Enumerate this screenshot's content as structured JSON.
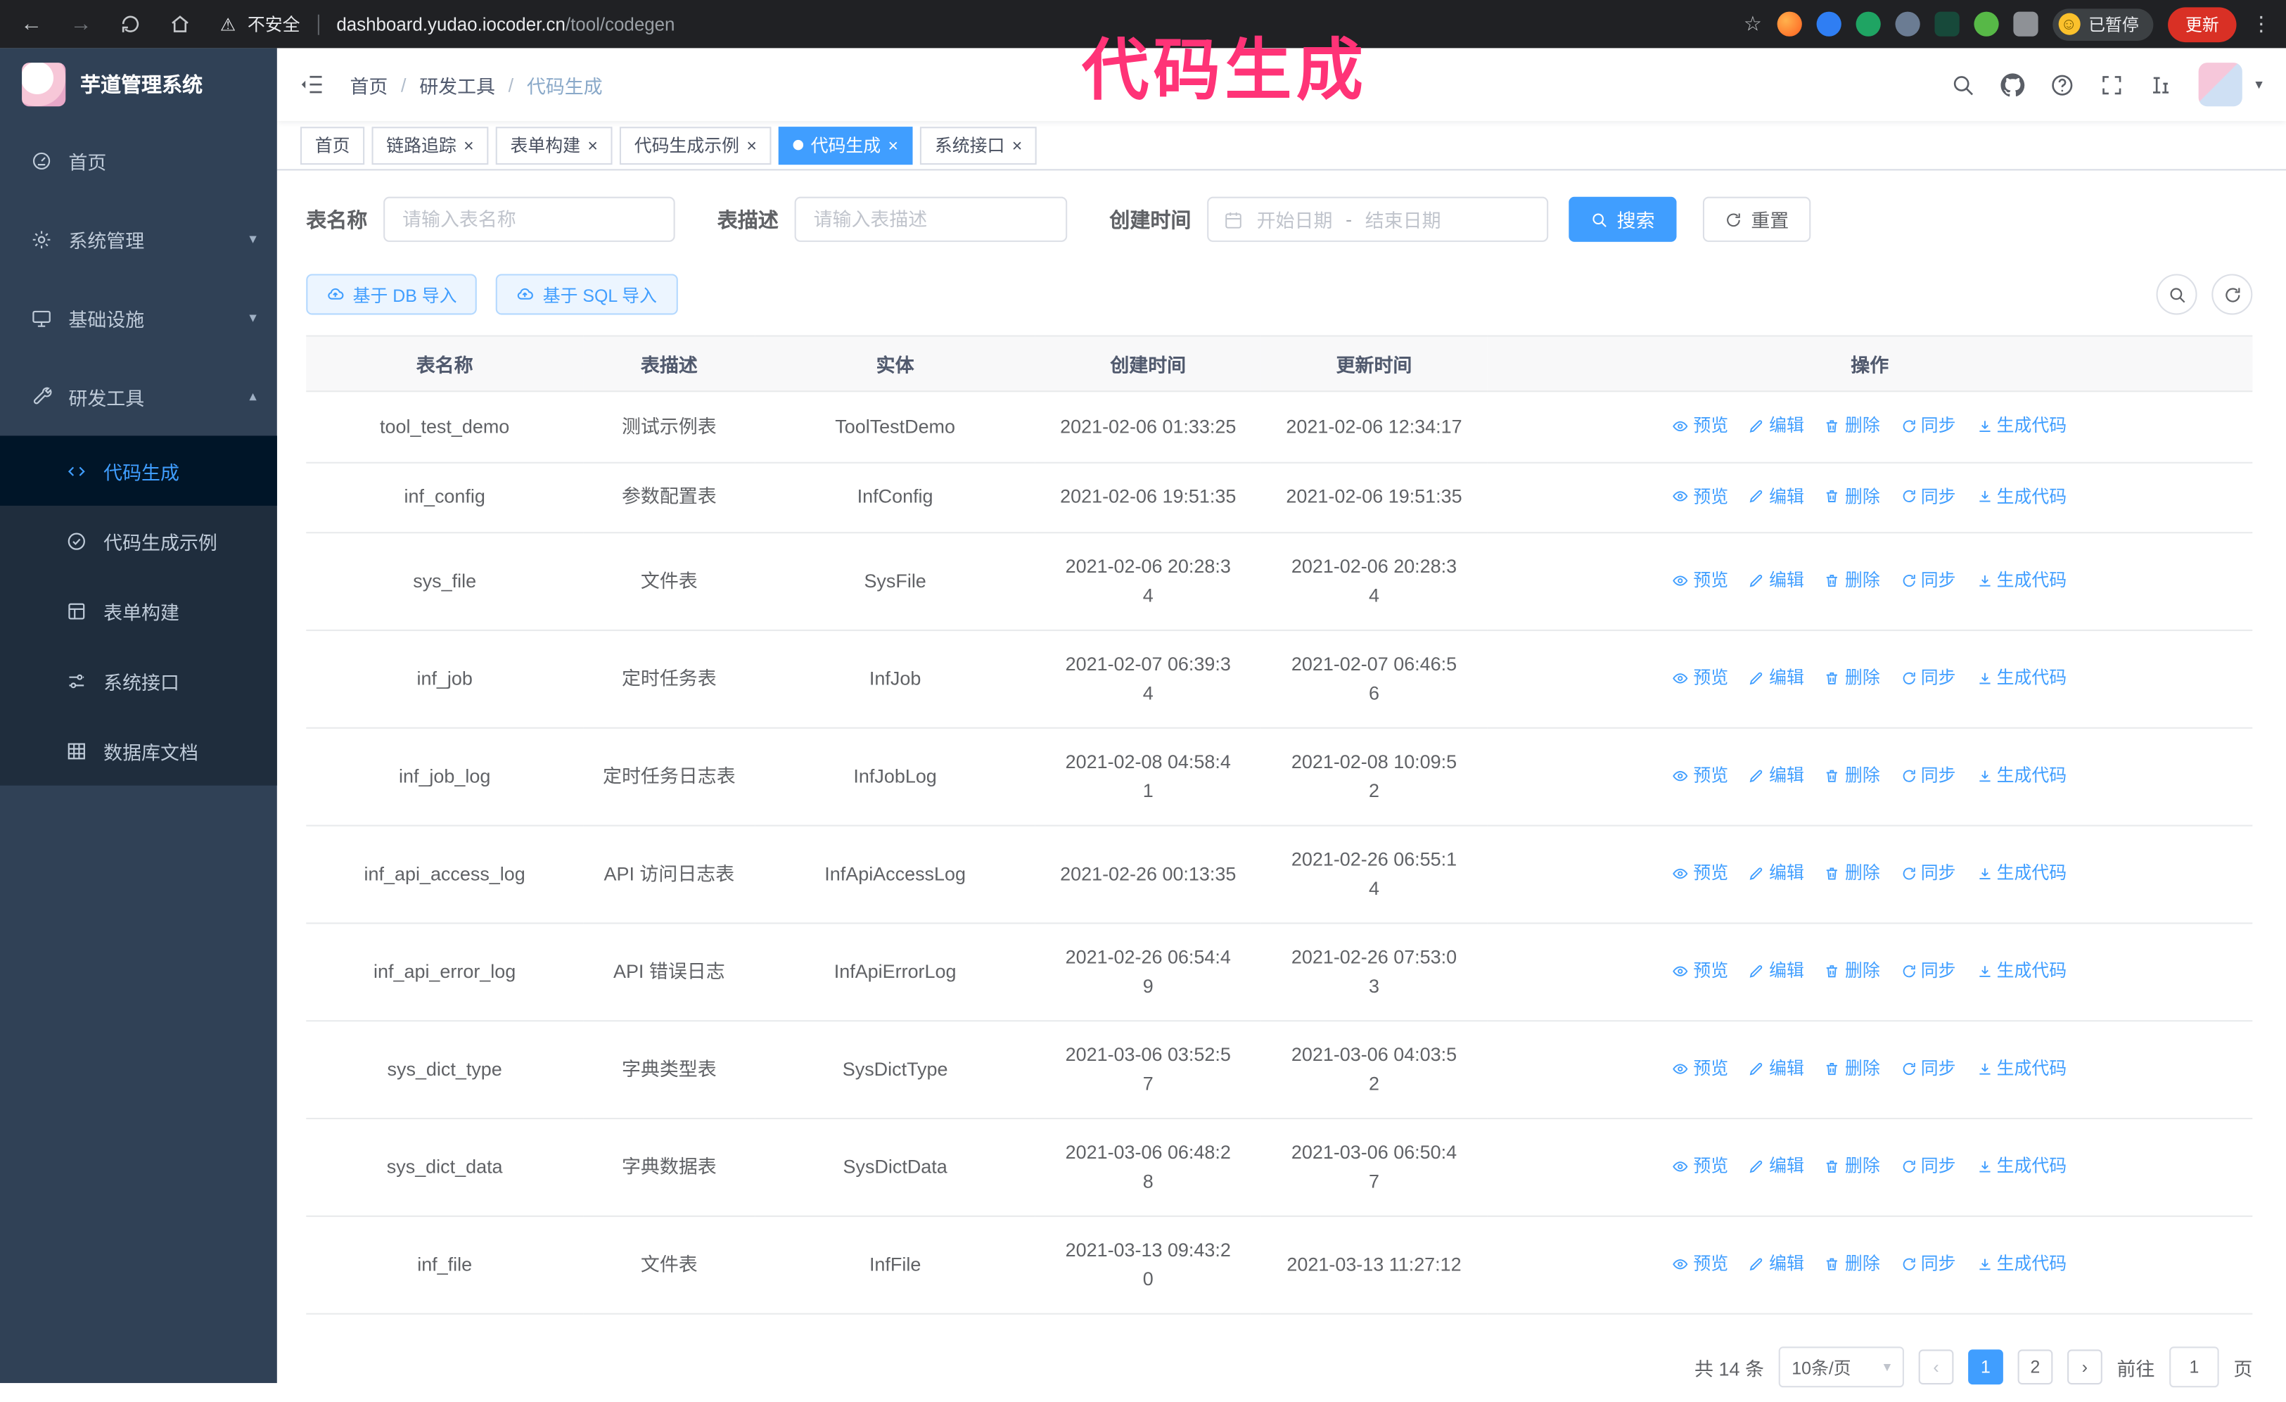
{
  "colors": {
    "accent": "#409eff",
    "sidebar_bg": "#304156",
    "submenu_bg": "#1f2d3d",
    "annotation": "#ff3377",
    "update_badge": "#d93025"
  },
  "icons": {
    "back": "←",
    "forward": "→",
    "star": "☆",
    "warning": "⚠",
    "dots": "⋮",
    "caret_down": "▾",
    "caret_up": "▴",
    "smiley": "☺",
    "close": "×",
    "prev": "‹",
    "next": "›"
  },
  "annotation": {
    "text": "代码生成"
  },
  "browser": {
    "security_warning": "不安全",
    "url_domain": "dashboard.yudao.iocoder.cn",
    "url_path": "/tool/codegen",
    "paused_badge": "已暂停",
    "update_button": "更新"
  },
  "sidebar": {
    "app_title": "芋道管理系统",
    "items": [
      {
        "label": "首页"
      },
      {
        "label": "系统管理"
      },
      {
        "label": "基础设施"
      },
      {
        "label": "研发工具"
      }
    ],
    "subitems": [
      {
        "label": "代码生成",
        "active": true
      },
      {
        "label": "代码生成示例"
      },
      {
        "label": "表单构建"
      },
      {
        "label": "系统接口"
      },
      {
        "label": "数据库文档"
      }
    ]
  },
  "header": {
    "breadcrumb": [
      "首页",
      "研发工具",
      "代码生成"
    ],
    "separator": "/"
  },
  "tabs": [
    {
      "label": "首页"
    },
    {
      "label": "链路追踪"
    },
    {
      "label": "表单构建"
    },
    {
      "label": "代码生成示例"
    },
    {
      "label": "代码生成"
    },
    {
      "label": "系统接口"
    }
  ],
  "filters": {
    "table_name_label": "表名称",
    "table_name_placeholder": "请输入表名称",
    "table_desc_label": "表描述",
    "table_desc_placeholder": "请输入表描述",
    "create_time_label": "创建时间",
    "start_date_placeholder": "开始日期",
    "range_separator": "-",
    "end_date_placeholder": "结束日期",
    "search_label": "搜索",
    "reset_label": "重置"
  },
  "toolbar": {
    "import_db_label": "基于 DB 导入",
    "import_sql_label": "基于 SQL 导入"
  },
  "table": {
    "columns": [
      "表名称",
      "表描述",
      "实体",
      "创建时间",
      "更新时间",
      "操作"
    ],
    "actions": [
      "预览",
      "编辑",
      "删除",
      "同步",
      "生成代码"
    ],
    "rows": [
      {
        "name": "tool_test_demo",
        "desc": "测试示例表",
        "entity": "ToolTestDemo",
        "created": "2021-02-06 01:33:25",
        "updated": "2021-02-06 12:34:17"
      },
      {
        "name": "inf_config",
        "desc": "参数配置表",
        "entity": "InfConfig",
        "created": "2021-02-06 19:51:35",
        "updated": "2021-02-06 19:51:35"
      },
      {
        "name": "sys_file",
        "desc": "文件表",
        "entity": "SysFile",
        "created": "2021-02-06 20:28:3\n4",
        "updated": "2021-02-06 20:28:3\n4"
      },
      {
        "name": "inf_job",
        "desc": "定时任务表",
        "entity": "InfJob",
        "created": "2021-02-07 06:39:3\n4",
        "updated": "2021-02-07 06:46:5\n6"
      },
      {
        "name": "inf_job_log",
        "desc": "定时任务日志表",
        "entity": "InfJobLog",
        "created": "2021-02-08 04:58:4\n1",
        "updated": "2021-02-08 10:09:5\n2"
      },
      {
        "name": "inf_api_access_log",
        "desc": "API 访问日志表",
        "entity": "InfApiAccessLog",
        "created": "2021-02-26 00:13:35",
        "updated": "2021-02-26 06:55:1\n4"
      },
      {
        "name": "inf_api_error_log",
        "desc": "API 错误日志",
        "entity": "InfApiErrorLog",
        "created": "2021-02-26 06:54:4\n9",
        "updated": "2021-02-26 07:53:0\n3"
      },
      {
        "name": "sys_dict_type",
        "desc": "字典类型表",
        "entity": "SysDictType",
        "created": "2021-03-06 03:52:5\n7",
        "updated": "2021-03-06 04:03:5\n2"
      },
      {
        "name": "sys_dict_data",
        "desc": "字典数据表",
        "entity": "SysDictData",
        "created": "2021-03-06 06:48:2\n8",
        "updated": "2021-03-06 06:50:4\n7"
      },
      {
        "name": "inf_file",
        "desc": "文件表",
        "entity": "InfFile",
        "created": "2021-03-13 09:43:2\n0",
        "updated": "2021-03-13 11:27:12"
      }
    ]
  },
  "pagination": {
    "total": "共 14 条",
    "page_size": "10条/页",
    "pages": [
      "1",
      "2"
    ],
    "goto_prefix": "前往",
    "goto_value": "1",
    "goto_suffix": "页"
  }
}
